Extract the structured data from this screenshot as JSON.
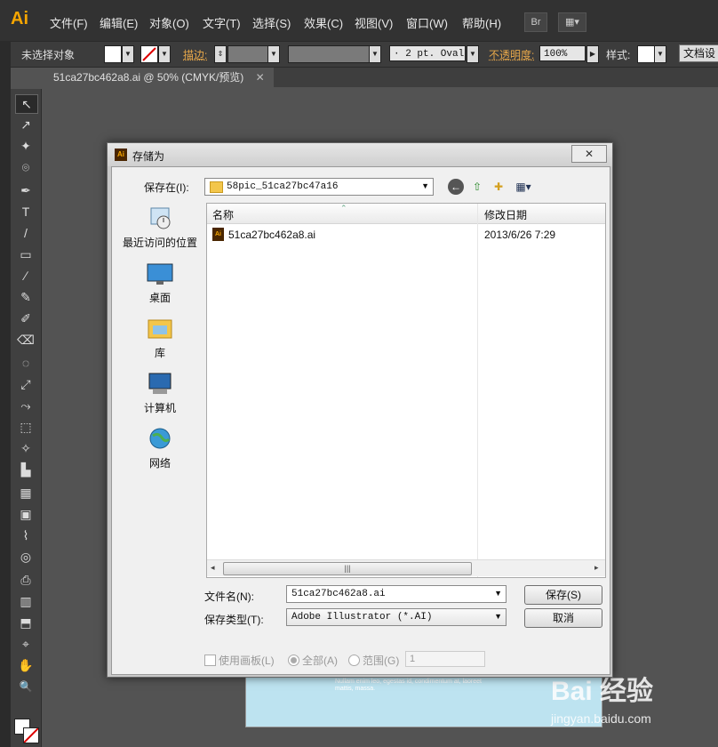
{
  "app": {
    "logo": "Ai"
  },
  "menu": [
    "文件(F)",
    "编辑(E)",
    "对象(O)",
    "文字(T)",
    "选择(S)",
    "效果(C)",
    "视图(V)",
    "窗口(W)",
    "帮助(H)"
  ],
  "menu_buttons": {
    "bridge": "Br",
    "arrange": "▦▾"
  },
  "controlbar": {
    "selection_status": "未选择对象",
    "stroke_label": "描边:",
    "brush_value": "· 2 pt. Oval",
    "opacity_label": "不透明度:",
    "opacity_value": "100%",
    "style_label": "样式:",
    "doc_setup_button": "文档设"
  },
  "document_tab": {
    "title": "51ca27bc462a8.ai @ 50% (CMYK/预览)",
    "close": "✕"
  },
  "tools": [
    "↖",
    "↗",
    "✦",
    "⌾",
    "✒",
    "T",
    "/",
    "▭",
    "∕",
    "✎",
    "✐",
    "⌫",
    "◌",
    "⤢",
    "⤳",
    "⬚",
    "✧",
    "▙",
    "▦",
    "▣",
    "⌇",
    "◎",
    "⎙",
    "▥",
    "⬒",
    "⌖",
    "✋",
    "🔍"
  ],
  "dialog": {
    "title": "存储为",
    "close": "✕",
    "save_in_label": "保存在(I):",
    "save_in_value": "58pic_51ca27bc47a16",
    "places": [
      {
        "label": "最近访问的位置",
        "icon": "recent-places-icon"
      },
      {
        "label": "桌面",
        "icon": "desktop-icon"
      },
      {
        "label": "库",
        "icon": "libraries-icon"
      },
      {
        "label": "计算机",
        "icon": "computer-icon"
      },
      {
        "label": "网络",
        "icon": "network-icon"
      }
    ],
    "columns": {
      "name": "名称",
      "modified": "修改日期"
    },
    "files": [
      {
        "name": "51ca27bc462a8.ai",
        "modified": "2013/6/26 7:29"
      }
    ],
    "filename_label": "文件名(N):",
    "filename_value": "51ca27bc462a8.ai",
    "filetype_label": "保存类型(T):",
    "filetype_value": "Adobe Illustrator (*.AI)",
    "save_button": "保存(S)",
    "cancel_button": "取消",
    "use_artboards_label": "使用画板(L)",
    "all_label": "全部(A)",
    "range_label": "范围(G)",
    "range_value": "1"
  },
  "artboard_text": "Nullam enim leo, egestas id, condimentum at, laoreet mattis, massa.",
  "watermark": {
    "brand": "Bai 经验",
    "url": "jingyan.baidu.com"
  }
}
